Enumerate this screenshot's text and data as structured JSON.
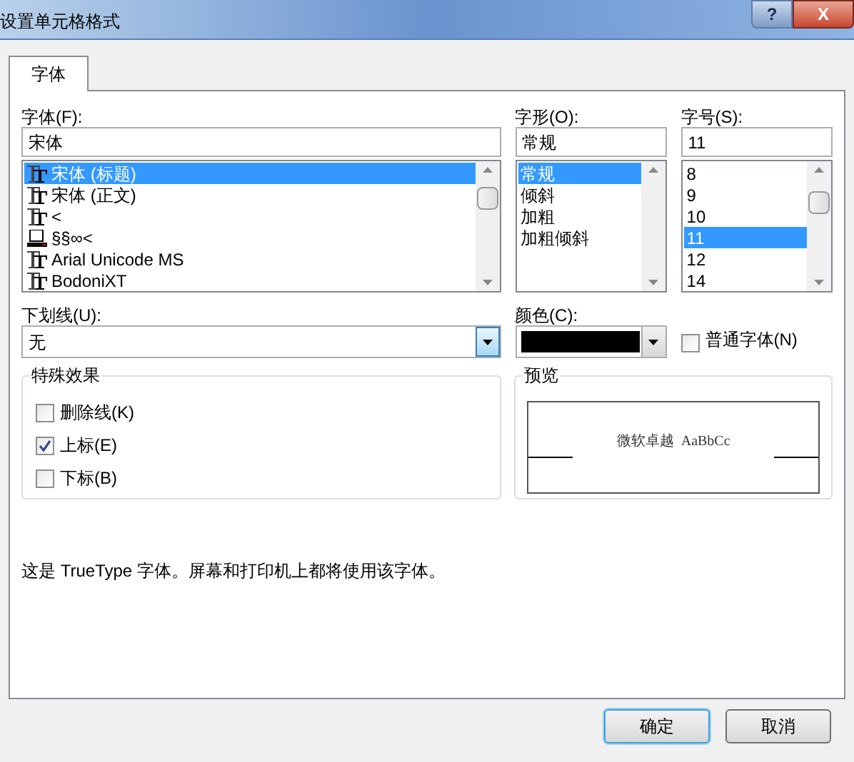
{
  "window": {
    "title": "设置单元格格式",
    "help": "?",
    "close": "X"
  },
  "tabs": [
    {
      "label": "字体",
      "selected": true
    }
  ],
  "font": {
    "label": "字体(F):",
    "value": "宋体",
    "items": [
      {
        "name": "宋体 (标题)",
        "kind": "truetype",
        "selected": true
      },
      {
        "name": "宋体 (正文)",
        "kind": "truetype",
        "selected": false
      },
      {
        "name": "<",
        "kind": "truetype",
        "selected": false
      },
      {
        "name": "§§∞<",
        "kind": "printer",
        "selected": false
      },
      {
        "name": "Arial Unicode MS",
        "kind": "truetype",
        "selected": false
      },
      {
        "name": "BodoniXT",
        "kind": "truetype",
        "selected": false
      }
    ]
  },
  "style": {
    "label": "字形(O):",
    "value": "常规",
    "items": [
      {
        "name": "常规",
        "selected": true
      },
      {
        "name": "倾斜",
        "selected": false
      },
      {
        "name": "加粗",
        "selected": false
      },
      {
        "name": "加粗倾斜",
        "selected": false
      }
    ]
  },
  "size": {
    "label": "字号(S):",
    "value": "11",
    "items": [
      {
        "name": "8",
        "selected": false
      },
      {
        "name": "9",
        "selected": false
      },
      {
        "name": "10",
        "selected": false
      },
      {
        "name": "11",
        "selected": true
      },
      {
        "name": "12",
        "selected": false
      },
      {
        "name": "14",
        "selected": false
      }
    ]
  },
  "underline": {
    "label": "下划线(U):",
    "value": "无"
  },
  "color": {
    "label": "颜色(C):",
    "color": "#000000"
  },
  "normal_font": {
    "label": "普通字体(N)",
    "checked": false
  },
  "effects": {
    "title": "特殊效果",
    "items": [
      {
        "label": "删除线(K)",
        "checked": false
      },
      {
        "label": "上标(E)",
        "checked": true
      },
      {
        "label": "下标(B)",
        "checked": false
      }
    ]
  },
  "preview": {
    "title": "预览",
    "text": "微软卓越  AaBbCc"
  },
  "description": "这是 TrueType 字体。屏幕和打印机上都将使用该字体。",
  "buttons": [
    {
      "label": "确定",
      "default": true
    },
    {
      "label": "取消",
      "default": false
    }
  ]
}
